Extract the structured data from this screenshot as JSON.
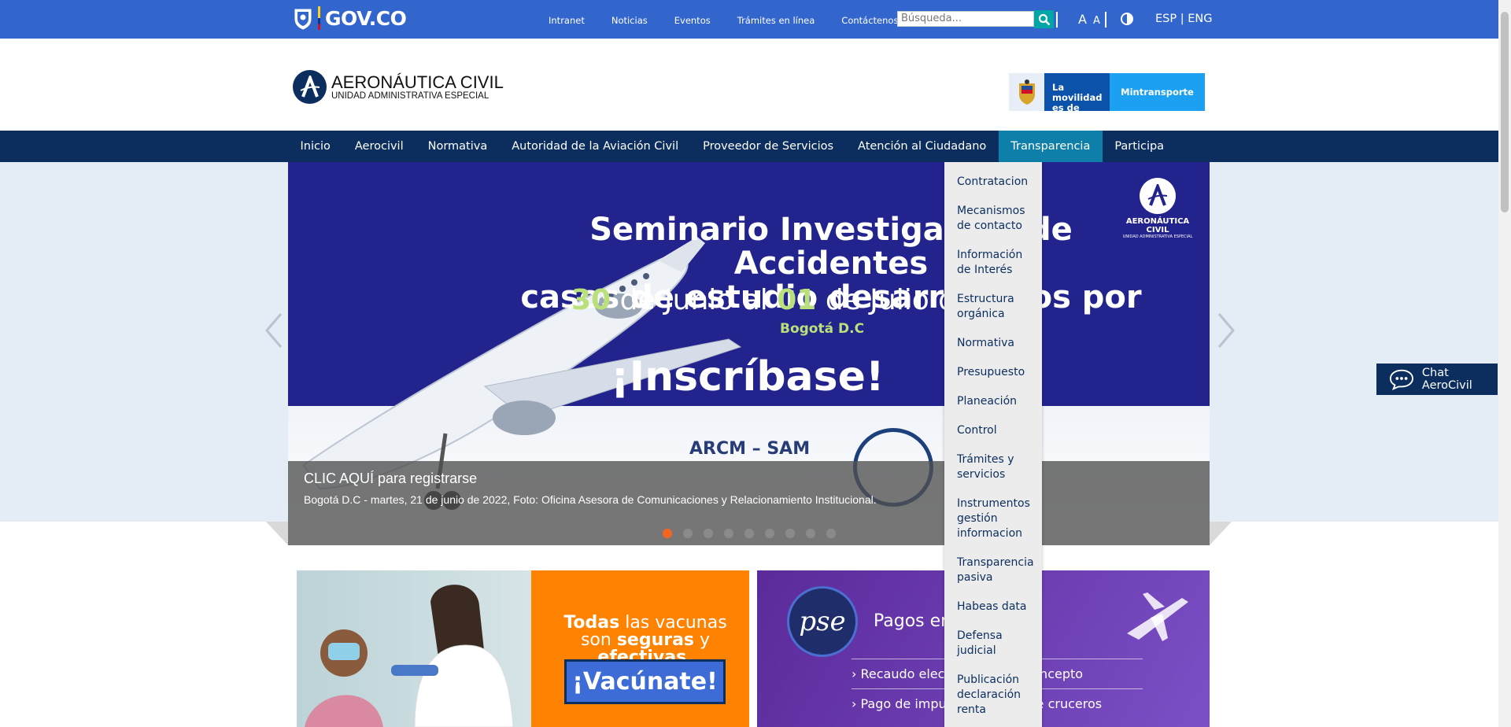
{
  "gov_bar": {
    "logo_text": "GOV.CO",
    "links": [
      "Intranet",
      "Noticias",
      "Eventos",
      "Trámites en línea",
      "Contáctenos"
    ],
    "search_placeholder": "Búsqueda...",
    "font_large": "A",
    "font_small": "A",
    "lang_es": "ESP",
    "lang_sep": "|",
    "lang_en": "ENG",
    "bg_color": "#3366cc"
  },
  "header": {
    "logo_title": "AERONÁUTICA CIVIL",
    "logo_subtitle": "UNIDAD ADMINISTRATIVA ESPECIAL",
    "partner_slogan": "La movilidad es de todos",
    "partner_name": "Mintransporte"
  },
  "main_nav": {
    "items": [
      {
        "label": "Inicio",
        "active": false
      },
      {
        "label": "Aerocivil",
        "active": false
      },
      {
        "label": "Normativa",
        "active": false
      },
      {
        "label": "Autoridad de la Aviación Civil",
        "active": false
      },
      {
        "label": "Proveedor de Servicios",
        "active": false
      },
      {
        "label": "Atención al Ciudadano",
        "active": false
      },
      {
        "label": "Transparencia",
        "active": true
      },
      {
        "label": "Participa",
        "active": false
      }
    ],
    "bg_color": "#0b2e5e",
    "active_color": "#0e7fa8"
  },
  "dropdown": {
    "items": [
      "Contratacion",
      "Mecanismos de contacto",
      "Información de Interés",
      "Estructura orgánica",
      "Normativa",
      "Presupuesto",
      "Planeación",
      "Control",
      "Trámites y servicios",
      "Instrumentos gestión informacion",
      "Transparencia pasiva",
      "Habeas data",
      "Defensa judicial",
      "Publicación declaración renta"
    ]
  },
  "carousel": {
    "slide_heading_line1": "Seminario Investigación de Accidentes",
    "slide_heading_line2": "casos de estudio desarrollados por",
    "slide_date_day1": "30",
    "slide_date_mid": "de Junio al",
    "slide_date_day2": "01",
    "slide_date_end": "de Julio de",
    "slide_city": "Bogotá D.C",
    "slide_cta": "¡Inscríbase!",
    "slide_partner": "ARCM – SAM",
    "slide_logo_l1": "AERONÁUTICA CIVIL",
    "slide_logo_l2": "UNIDAD ADMINISTRATIVA ESPECIAL",
    "caption_title": "CLIC AQUÍ para registrarse",
    "caption_text": "Bogotá D.C - martes, 21 de junio de 2022, Foto: Oficina Asesora de Comunicaciones y Relacionamiento Institucional.",
    "dot_count": 9,
    "active_dot": 0,
    "active_dot_color": "#f26522"
  },
  "chat": {
    "label": "Chat AeroCivil"
  },
  "cards": {
    "vaccine_bold1": "Todas",
    "vaccine_text1": "las vacunas son",
    "vaccine_bold2": "seguras",
    "vaccine_text2": "y",
    "vaccine_bold3": "efectivas.",
    "vaccine_button": "¡Vacúnate!",
    "pse_logo": "pse",
    "pse_title": "Pagos en",
    "pse_line1": "Recaudo elec          uier tipo de concepto",
    "pse_line2": "Pago de impu          ara viajeros de cruceros"
  }
}
